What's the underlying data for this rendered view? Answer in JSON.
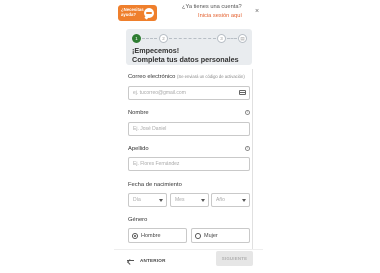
{
  "header": {
    "help_label": "¿Necesitas ayuda?",
    "account_question": "¿Ya tienes una cuenta?",
    "login_link": "Inicia sesión aquí",
    "close_label": "×"
  },
  "progress": {
    "steps": [
      {
        "label": "1",
        "state": "active"
      },
      {
        "label": "2",
        "state": "pending"
      },
      {
        "label": "3",
        "state": "pending"
      },
      {
        "label": "▤",
        "state": "pending"
      }
    ]
  },
  "banner": {
    "title_line1": "¡Empecemos!",
    "title_line2": "Completa tus datos personales"
  },
  "form": {
    "email": {
      "label": "Correo electrónico",
      "hint": "(Se enviará un código de activación)",
      "placeholder": "ej. tucorreo@gmail.com"
    },
    "name": {
      "label": "Nombre",
      "placeholder": "Ej. José Daniel"
    },
    "surname": {
      "label": "Apellido",
      "placeholder": "Ej. Flores Fernández"
    },
    "birth": {
      "label": "Fecha de nacimiento",
      "day": "Día",
      "month": "Mes",
      "year": "Año"
    },
    "gender": {
      "label": "Género",
      "options": [
        "Hombre",
        "Mujer"
      ],
      "selected": "Hombre"
    }
  },
  "footer": {
    "back_label": "ANTERIOR",
    "next_label": "SIGUIENTE"
  },
  "colors": {
    "accent": "#ef7f2c",
    "link": "#e35d2a",
    "step_active": "#2e7d32",
    "banner_bg": "#e9ecef"
  }
}
